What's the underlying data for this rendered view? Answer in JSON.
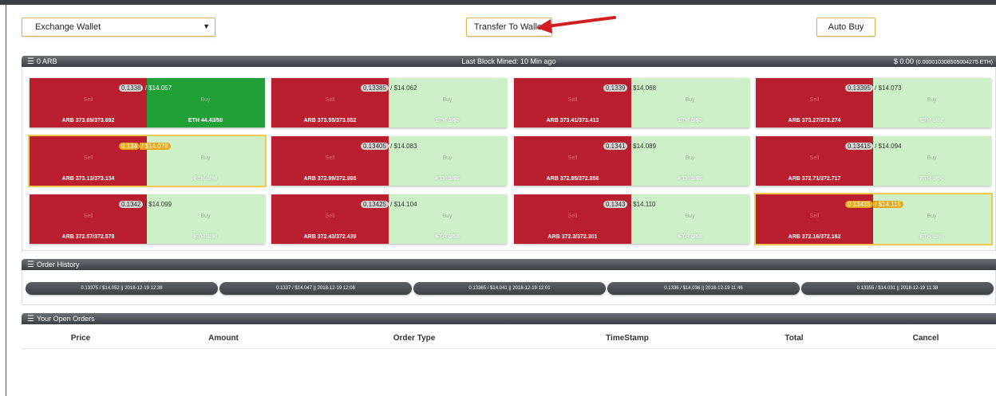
{
  "wallet": {
    "selected": "Exchange Wallet"
  },
  "toolbar": {
    "transfer_label": "Transfer To Wallet",
    "autobuy_label": "Auto Buy"
  },
  "market": {
    "header_left": "0 ARB",
    "header_center": "Last Block Mined: 10 Min ago",
    "header_right_main": "$ 0.00",
    "header_right_small": "(0.000010308505004275 ETH)",
    "sell_label": "Sell",
    "buy_label": "Buy",
    "cards": [
      {
        "price": "0.1338",
        "usd": "$14.057",
        "sell": "ARB 373.69/373.692",
        "buy": "ETH 44.43/50"
      },
      {
        "price": "0.13385",
        "usd": "$14.062",
        "sell": "ARB 373.55/373.552",
        "buy": "ETH 0/50"
      },
      {
        "price": "0.1339",
        "usd": "$14.068",
        "sell": "ARB 373.41/373.413",
        "buy": "ETH 0/50"
      },
      {
        "price": "0.13395",
        "usd": "$14.073",
        "sell": "ARB 373.27/373.274",
        "buy": "ETH 0/50"
      },
      {
        "price": "0.134",
        "usd": "$14.078",
        "sell": "ARB 373.13/373.134",
        "buy": "ETH 0/50"
      },
      {
        "price": "0.13405",
        "usd": "$14.083",
        "sell": "ARB 372.99/372.995",
        "buy": "ETH 0/50"
      },
      {
        "price": "0.1341",
        "usd": "$14.089",
        "sell": "ARB 372.85/372.856",
        "buy": "ETH 0/50"
      },
      {
        "price": "0.13415",
        "usd": "$14.094",
        "sell": "ARB 372.71/372.717",
        "buy": "ETH 0/50"
      },
      {
        "price": "0.1342",
        "usd": "$14.099",
        "sell": "ARB 372.57/372.578",
        "buy": "ETH 0/50"
      },
      {
        "price": "0.13425",
        "usd": "$14.104",
        "sell": "ARB 372.43/372.439",
        "buy": "ETH 0/50"
      },
      {
        "price": "0.1343",
        "usd": "$14.110",
        "sell": "ARB 372.3/372.301",
        "buy": "ETH 0/50"
      },
      {
        "price": "0.13435",
        "usd": "$14.115",
        "sell": "ARB 372.16/372.162",
        "buy": "ETH 0/50"
      }
    ]
  },
  "history": {
    "title": "Order History",
    "items": [
      "0.13375 / $14.052 || 2018-12-19 12:38",
      "0.1337 / $14.047 || 2018-12-19 12:08",
      "0.13365 / $14.041 || 2018-12-19 12:01",
      "0.1336 / $14.036 || 2018-12-19 11:46",
      "0.13355 / $14.031 || 2018-12-19 11:38"
    ]
  },
  "open_orders": {
    "title": "Your Open Orders",
    "columns": [
      "Price",
      "Amount",
      "Order Type",
      "TimeStamp",
      "Total",
      "Cancel"
    ]
  }
}
